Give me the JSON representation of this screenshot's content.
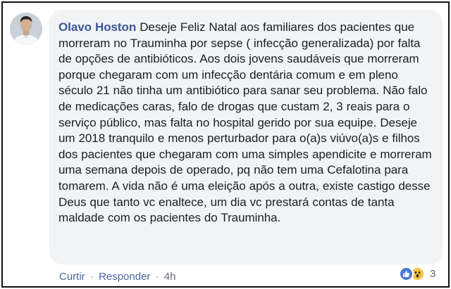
{
  "comment": {
    "author": "Olavo Hoston",
    "text": "Deseje Feliz Natal aos familiares dos pacientes que morreram no Trauminha por sepse ( infecção generalizada) por falta de opções de antibióticos. Aos dois jovens saudáveis que morreram porque chegaram com um infecção dentária comum e em pleno século 21 não tinha um antibiótico para sanar seu problema. Não falo de medicações caras, falo de drogas que custam 2, 3 reais para o serviço público, mas falta no hospital gerido por sua equipe. Deseje um 2018 tranquilo e menos perturbador para o(a)s viúvo(a)s e filhos dos pacientes que chegaram com uma simples apendicite e morreram uma semana depois de operado, pq não tem uma Cefalotina para tomarem. A vida não é uma eleição após a outra, existe castigo desse Deus que tanto vc enaltece, um dia vc prestará contas de tanta maldade com os pacientes do Trauminha."
  },
  "actions": {
    "like_label": "Curtir",
    "reply_label": "Responder",
    "separator": "·",
    "time": "4h"
  },
  "reactions": {
    "icons": [
      "like-icon",
      "wow-icon"
    ],
    "count": "3",
    "colors": {
      "like": "#4a76d4",
      "wow": "#f5c33b"
    }
  },
  "colors": {
    "author": "#385898",
    "bubble": "#f2f3f5",
    "text": "#1c1e21",
    "action_link": "#4b67a1"
  }
}
